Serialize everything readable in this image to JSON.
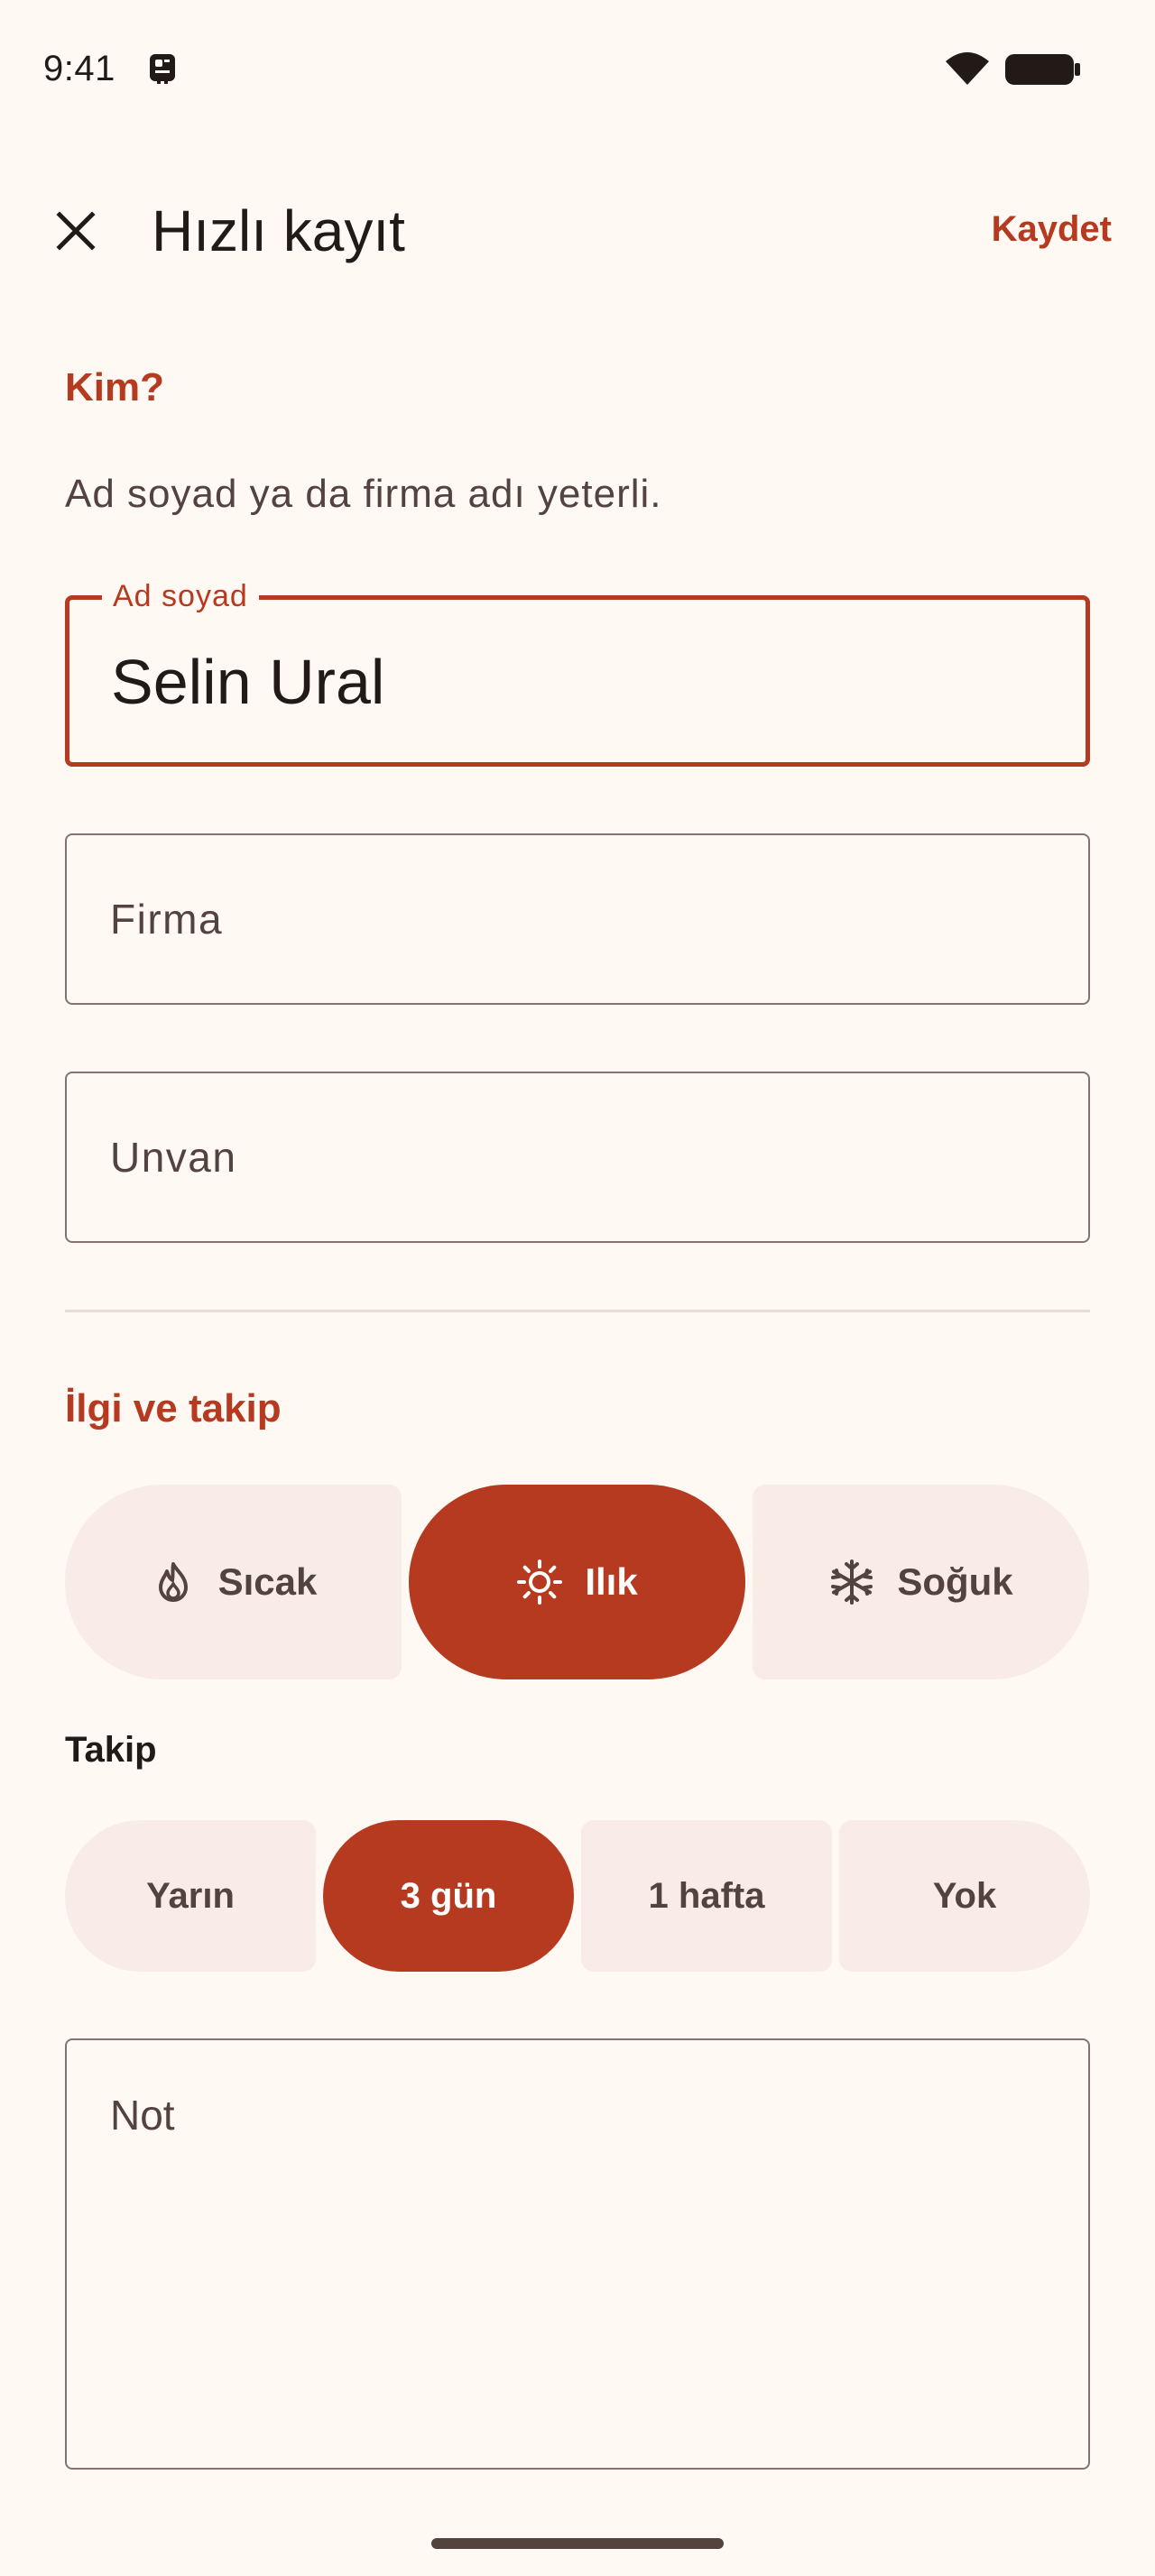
{
  "status_bar": {
    "time": "9:41"
  },
  "app_bar": {
    "title": "Hızlı kayıt",
    "save_label": "Kaydet"
  },
  "who_section": {
    "heading": "Kim?",
    "helper": "Ad soyad ya da firma adı yeterli.",
    "name_field": {
      "label": "Ad soyad",
      "value": "Selin Ural"
    },
    "company_field": {
      "placeholder": "Firma"
    },
    "title_field": {
      "placeholder": "Unvan"
    }
  },
  "interest_section": {
    "heading": "İlgi ve takip",
    "temperature": [
      {
        "label": "Sıcak",
        "icon": "flame-icon",
        "selected": false
      },
      {
        "label": "Ilık",
        "icon": "sun-icon",
        "selected": true
      },
      {
        "label": "Soğuk",
        "icon": "snowflake-icon",
        "selected": false
      }
    ],
    "follow_label": "Takip",
    "follow_options": [
      {
        "label": "Yarın",
        "selected": false
      },
      {
        "label": "3 gün",
        "selected": true
      },
      {
        "label": "1 hafta",
        "selected": false
      },
      {
        "label": "Yok",
        "selected": false
      }
    ]
  },
  "note_field": {
    "placeholder": "Not"
  },
  "colors": {
    "accent": "#B53A1F",
    "background": "#FFF8F3",
    "segment_unselected": "#F9EBE5",
    "outline": "#85736E",
    "text_primary": "#231917",
    "text_secondary": "#53433F"
  }
}
